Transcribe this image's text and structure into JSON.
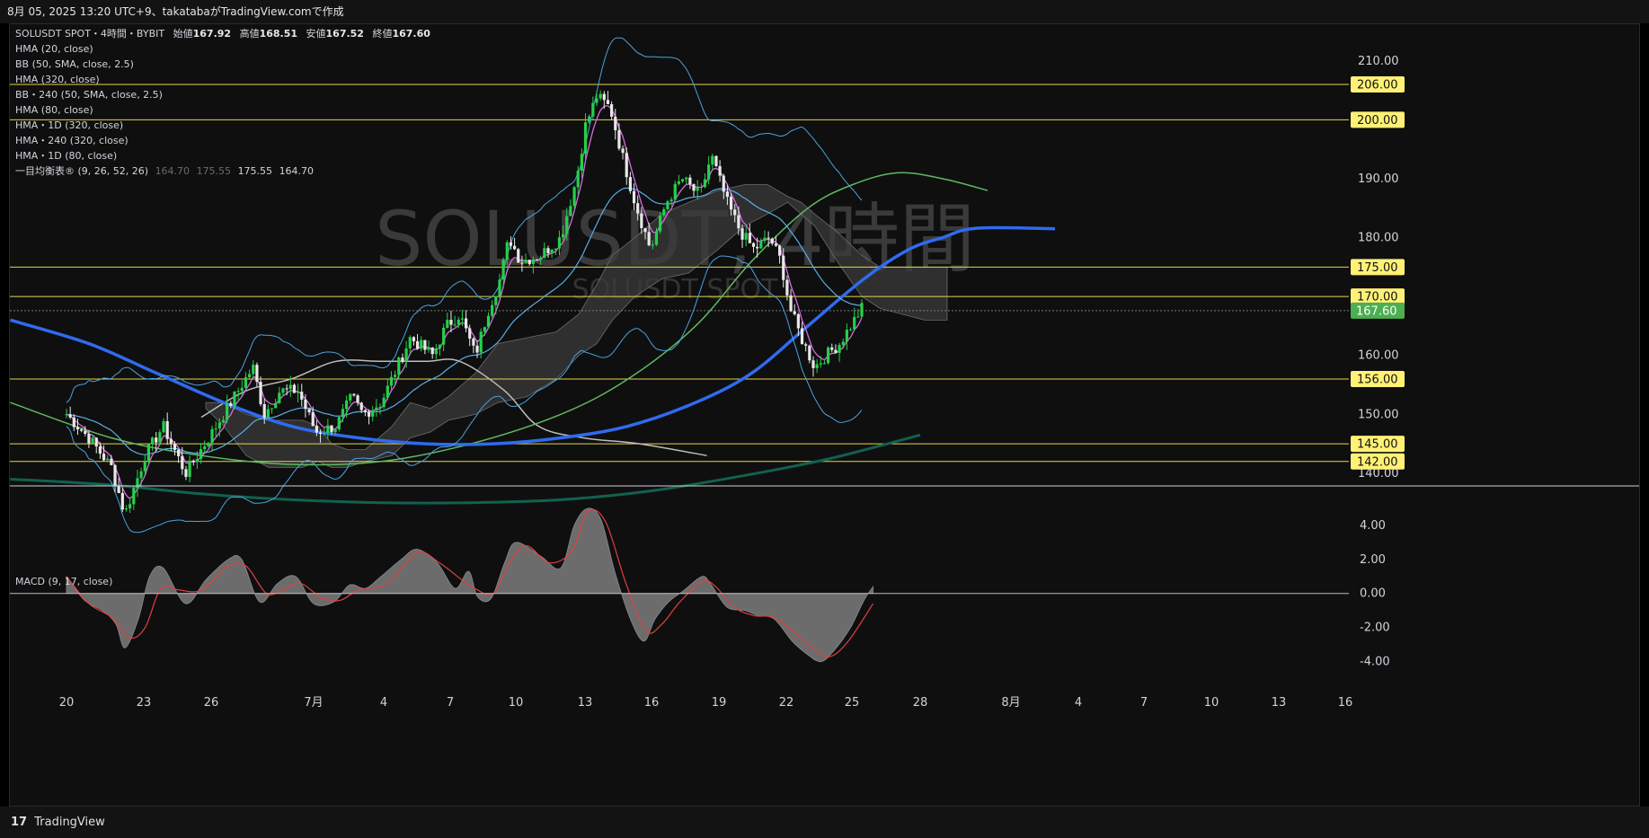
{
  "header": {
    "text": "8月 05, 2025 13:20 UTC+9、takatabaがTradingView.comで作成"
  },
  "legend": {
    "symbol": "SOLUSDT SPOT・4時間・BYBIT",
    "ohlc": [
      {
        "label": "始値",
        "value": "167.92"
      },
      {
        "label": "高値",
        "value": "168.51"
      },
      {
        "label": "安値",
        "value": "167.52"
      },
      {
        "label": "終値",
        "value": "167.60"
      }
    ],
    "indicators": [
      "HMA (20, close)",
      "BB (50, SMA, close, 2.5)",
      "HMA (320, close)",
      "BB・240 (50, SMA, close, 2.5)",
      "HMA (80, close)",
      "HMA・1D (320, close)",
      "HMA・240 (320, close)",
      "HMA・1D (80, close)"
    ],
    "ichimoku": {
      "label": "一目均衡表® (9, 26, 52, 26)",
      "values": [
        "164.70",
        "175.55",
        "175.55",
        "164.70"
      ]
    },
    "macd": "MACD (9, 17, close)"
  },
  "watermark": {
    "main": "SOLUSDT, 4時間",
    "sub": "SOLUSDT SPOT"
  },
  "footer": {
    "logo": "17",
    "text": "TradingView"
  },
  "colors": {
    "background": "#0f0f0f",
    "up": "#26d04a",
    "down": "#e8e8e8",
    "level_line": "#e6d64a",
    "level_label_bg": "#fff176",
    "current_price": "#4caf50",
    "bb": "#4aa3df",
    "hma20": "#d86be0",
    "hma80": "#5fb95f",
    "hma320": "#2f6bf0",
    "hma_1d_320": "#11614f",
    "hma_1d_80": "#bdbdbd",
    "cloud": "#3b3b3b",
    "macd_hist": "#777777",
    "macd_signal": "#e04040"
  },
  "chart_data": [
    {
      "type": "candlestick",
      "title": "SOLUSDT SPOT・4時間・BYBIT",
      "x_tick_labels": [
        "20",
        "23",
        "26",
        "7月",
        "4",
        "7",
        "10",
        "13",
        "16",
        "19",
        "22",
        "25",
        "28",
        "8月",
        "4",
        "7",
        "10",
        "13",
        "16"
      ],
      "y_tick_labels": [
        "140.00",
        "150.00",
        "160.00",
        "180.00",
        "190.00",
        "210.00"
      ],
      "ylim": [
        138,
        215
      ],
      "horizontal_levels": [
        142,
        145,
        156,
        170,
        175,
        200,
        206
      ],
      "current_price": 167.6,
      "close_path": [
        {
          "x": 0,
          "y": 150
        },
        {
          "x": 1,
          "y": 146
        },
        {
          "x": 2,
          "y": 141
        },
        {
          "x": 2.6,
          "y": 133
        },
        {
          "x": 3.5,
          "y": 143
        },
        {
          "x": 4.3,
          "y": 148
        },
        {
          "x": 5.3,
          "y": 140
        },
        {
          "x": 6.5,
          "y": 147
        },
        {
          "x": 7.8,
          "y": 155
        },
        {
          "x": 8.3,
          "y": 158
        },
        {
          "x": 8.8,
          "y": 150
        },
        {
          "x": 9.5,
          "y": 154
        },
        {
          "x": 10.3,
          "y": 154
        },
        {
          "x": 11.1,
          "y": 147
        },
        {
          "x": 12,
          "y": 148
        },
        {
          "x": 12.7,
          "y": 153
        },
        {
          "x": 13.2,
          "y": 150
        },
        {
          "x": 14.0,
          "y": 152
        },
        {
          "x": 14.6,
          "y": 157
        },
        {
          "x": 15.3,
          "y": 163
        },
        {
          "x": 16.3,
          "y": 160
        },
        {
          "x": 16.9,
          "y": 165
        },
        {
          "x": 17.5,
          "y": 167
        },
        {
          "x": 18.2,
          "y": 160
        },
        {
          "x": 18.8,
          "y": 168
        },
        {
          "x": 19.3,
          "y": 173
        },
        {
          "x": 19.7,
          "y": 180
        },
        {
          "x": 20.2,
          "y": 176
        },
        {
          "x": 21.1,
          "y": 177
        },
        {
          "x": 22.0,
          "y": 180
        },
        {
          "x": 22.7,
          "y": 190
        },
        {
          "x": 23.1,
          "y": 199
        },
        {
          "x": 23.6,
          "y": 204
        },
        {
          "x": 24.2,
          "y": 202
        },
        {
          "x": 24.8,
          "y": 193
        },
        {
          "x": 25.3,
          "y": 186
        },
        {
          "x": 26.0,
          "y": 178
        },
        {
          "x": 26.7,
          "y": 186
        },
        {
          "x": 27.4,
          "y": 190
        },
        {
          "x": 28.2,
          "y": 187
        },
        {
          "x": 28.7,
          "y": 194
        },
        {
          "x": 29.4,
          "y": 186
        },
        {
          "x": 30.0,
          "y": 181
        },
        {
          "x": 30.6,
          "y": 178
        },
        {
          "x": 31.3,
          "y": 180
        },
        {
          "x": 31.8,
          "y": 176
        },
        {
          "x": 32.2,
          "y": 168
        },
        {
          "x": 32.7,
          "y": 163
        },
        {
          "x": 33.3,
          "y": 158
        },
        {
          "x": 33.8,
          "y": 160
        },
        {
          "x": 34.4,
          "y": 162
        },
        {
          "x": 34.9,
          "y": 165
        },
        {
          "x": 35.4,
          "y": 168
        }
      ]
    },
    {
      "type": "area",
      "title": "MACD (9, 17, close)",
      "y_tick_labels": [
        "4.00",
        "2.00",
        "0.00",
        "-2.00",
        "-4.00"
      ],
      "ylim": [
        -5.5,
        6
      ],
      "macd_path": [
        {
          "x": 0,
          "y": 1.0
        },
        {
          "x": 0.8,
          "y": -0.4
        },
        {
          "x": 1.6,
          "y": -1.0
        },
        {
          "x": 2.2,
          "y": -1.8
        },
        {
          "x": 2.6,
          "y": -3.2
        },
        {
          "x": 3.2,
          "y": -1.5
        },
        {
          "x": 3.7,
          "y": 1.0
        },
        {
          "x": 4.3,
          "y": 1.5
        },
        {
          "x": 5.3,
          "y": -0.6
        },
        {
          "x": 6.2,
          "y": 0.8
        },
        {
          "x": 7.2,
          "y": 2.0
        },
        {
          "x": 7.8,
          "y": 2.0
        },
        {
          "x": 8.6,
          "y": -0.5
        },
        {
          "x": 9.4,
          "y": 0.6
        },
        {
          "x": 10.2,
          "y": 1.0
        },
        {
          "x": 11.0,
          "y": -0.6
        },
        {
          "x": 11.9,
          "y": -0.5
        },
        {
          "x": 12.6,
          "y": 0.5
        },
        {
          "x": 13.3,
          "y": 0.3
        },
        {
          "x": 14.0,
          "y": 1.0
        },
        {
          "x": 14.9,
          "y": 2.0
        },
        {
          "x": 15.6,
          "y": 2.6
        },
        {
          "x": 16.5,
          "y": 1.8
        },
        {
          "x": 17.3,
          "y": 0.3
        },
        {
          "x": 17.9,
          "y": 1.3
        },
        {
          "x": 18.3,
          "y": -0.2
        },
        {
          "x": 18.9,
          "y": -0.3
        },
        {
          "x": 19.5,
          "y": 1.8
        },
        {
          "x": 20.0,
          "y": 3.0
        },
        {
          "x": 21.1,
          "y": 2.2
        },
        {
          "x": 22.0,
          "y": 1.5
        },
        {
          "x": 22.6,
          "y": 4.0
        },
        {
          "x": 23.2,
          "y": 5.0
        },
        {
          "x": 23.8,
          "y": 4.3
        },
        {
          "x": 24.4,
          "y": 1.3
        },
        {
          "x": 25.1,
          "y": -1.5
        },
        {
          "x": 25.7,
          "y": -2.8
        },
        {
          "x": 26.2,
          "y": -1.5
        },
        {
          "x": 26.8,
          "y": -0.5
        },
        {
          "x": 27.5,
          "y": 0.2
        },
        {
          "x": 28.3,
          "y": 1.0
        },
        {
          "x": 28.7,
          "y": 0.5
        },
        {
          "x": 29.4,
          "y": -0.8
        },
        {
          "x": 30.2,
          "y": -1.0
        },
        {
          "x": 30.8,
          "y": -1.3
        },
        {
          "x": 31.5,
          "y": -1.5
        },
        {
          "x": 32.3,
          "y": -2.8
        },
        {
          "x": 33.0,
          "y": -3.6
        },
        {
          "x": 33.6,
          "y": -4.0
        },
        {
          "x": 34.2,
          "y": -3.3
        },
        {
          "x": 34.9,
          "y": -2.0
        },
        {
          "x": 35.5,
          "y": -0.4
        },
        {
          "x": 35.9,
          "y": 0.4
        }
      ],
      "signal_path": [
        {
          "x": 0,
          "y": 1.0
        },
        {
          "x": 1.0,
          "y": -0.6
        },
        {
          "x": 2.0,
          "y": -1.4
        },
        {
          "x": 2.8,
          "y": -2.6
        },
        {
          "x": 3.5,
          "y": -2.0
        },
        {
          "x": 4.2,
          "y": 0.3
        },
        {
          "x": 5.0,
          "y": 0.2
        },
        {
          "x": 6.0,
          "y": 0.2
        },
        {
          "x": 7.2,
          "y": 1.6
        },
        {
          "x": 8.0,
          "y": 1.6
        },
        {
          "x": 8.9,
          "y": 0.0
        },
        {
          "x": 9.6,
          "y": 0.2
        },
        {
          "x": 10.4,
          "y": 0.6
        },
        {
          "x": 11.4,
          "y": -0.3
        },
        {
          "x": 12.2,
          "y": -0.4
        },
        {
          "x": 13.0,
          "y": 0.2
        },
        {
          "x": 14.3,
          "y": 0.6
        },
        {
          "x": 15.6,
          "y": 2.4
        },
        {
          "x": 16.6,
          "y": 1.8
        },
        {
          "x": 17.6,
          "y": 0.8
        },
        {
          "x": 18.3,
          "y": 0.2
        },
        {
          "x": 19.0,
          "y": 0.0
        },
        {
          "x": 19.8,
          "y": 2.0
        },
        {
          "x": 20.5,
          "y": 2.8
        },
        {
          "x": 21.5,
          "y": 1.8
        },
        {
          "x": 22.5,
          "y": 2.5
        },
        {
          "x": 23.2,
          "y": 4.8
        },
        {
          "x": 24.0,
          "y": 4.2
        },
        {
          "x": 24.9,
          "y": 0.6
        },
        {
          "x": 25.8,
          "y": -2.2
        },
        {
          "x": 26.5,
          "y": -1.8
        },
        {
          "x": 27.3,
          "y": -0.5
        },
        {
          "x": 28.3,
          "y": 0.7
        },
        {
          "x": 28.9,
          "y": 0.4
        },
        {
          "x": 29.7,
          "y": -0.8
        },
        {
          "x": 30.6,
          "y": -1.3
        },
        {
          "x": 31.5,
          "y": -1.4
        },
        {
          "x": 32.4,
          "y": -2.3
        },
        {
          "x": 33.3,
          "y": -3.3
        },
        {
          "x": 34.0,
          "y": -3.7
        },
        {
          "x": 34.8,
          "y": -2.8
        },
        {
          "x": 35.9,
          "y": -0.6
        }
      ]
    }
  ]
}
